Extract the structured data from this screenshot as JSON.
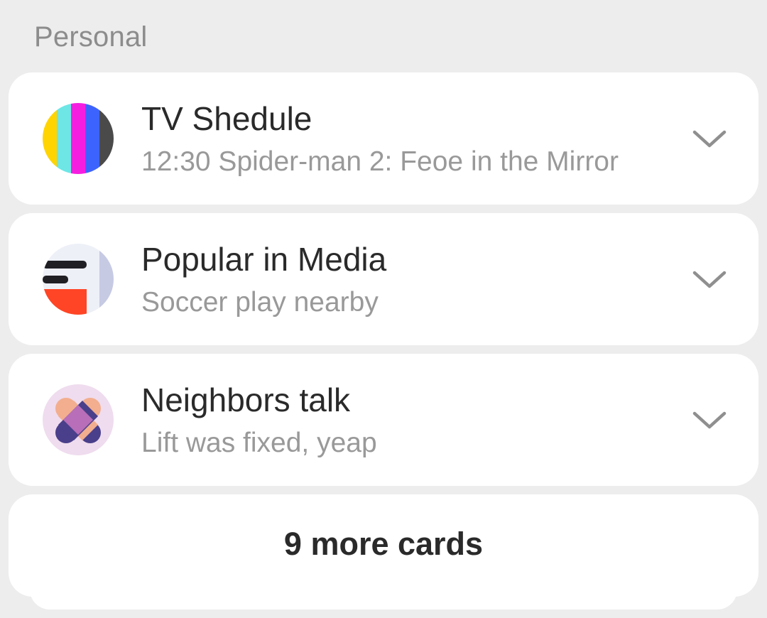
{
  "section": {
    "title": "Personal"
  },
  "cards": [
    {
      "title": "TV Shedule",
      "subtitle": "12:30 Spider-man 2: Feoe in the Mirror",
      "icon": "tv-schedule-icon"
    },
    {
      "title": "Popular in Media",
      "subtitle": "Soccer play nearby",
      "icon": "media-icon"
    },
    {
      "title": "Neighbors talk",
      "subtitle": "Lift was fixed, yeap",
      "icon": "neighbors-icon"
    }
  ],
  "more": {
    "label": "9 more cards"
  },
  "colors": {
    "background": "#ededed",
    "card": "#ffffff",
    "title": "#2a2a2a",
    "subtitle": "#999999",
    "section_title": "#8c8c8c",
    "chevron": "#8f8f8f"
  }
}
